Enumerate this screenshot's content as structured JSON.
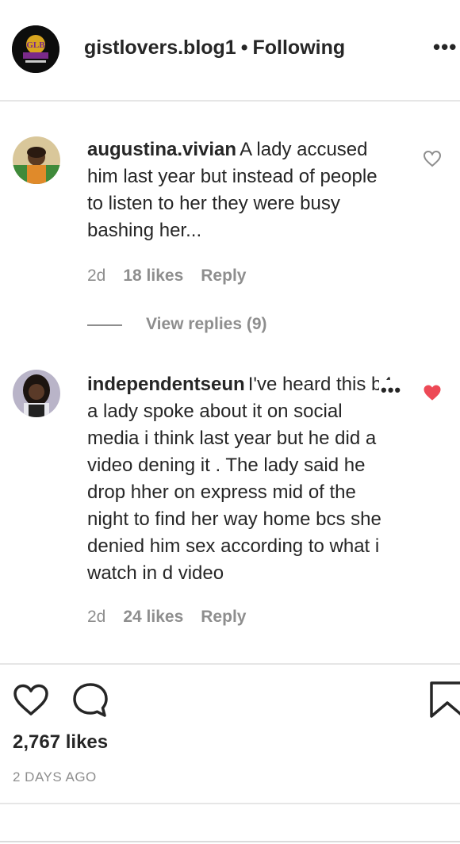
{
  "header": {
    "username": "gistlovers.blog1",
    "separator": "•",
    "follow_status": "Following",
    "logo_text": "GLB",
    "more_icon": "more-horizontal-icon"
  },
  "comments": [
    {
      "username": "augustina.vivian",
      "text": "A lady accused him last year but instead of people to listen to her they were busy bashing her...",
      "age": "2d",
      "likes": "18 likes",
      "reply_label": "Reply",
      "view_replies": "View replies (9)",
      "liked": false
    },
    {
      "username": "independentseun",
      "text": "I've heard this b4 a lady spoke about it on social media i think last year but he did a video dening it . The lady said he drop hher on express mid of the night to find her way home bcs she denied him sex according to what i watch in d video",
      "age": "2d",
      "likes": "24 likes",
      "reply_label": "Reply",
      "liked": true
    }
  ],
  "footer": {
    "likes_total": "2,767 likes",
    "time_ago": "2 DAYS AGO"
  },
  "colors": {
    "text": "#262626",
    "muted": "#8e8e8e",
    "liked_heart": "#ed4956",
    "divider": "#e6e6e6"
  }
}
